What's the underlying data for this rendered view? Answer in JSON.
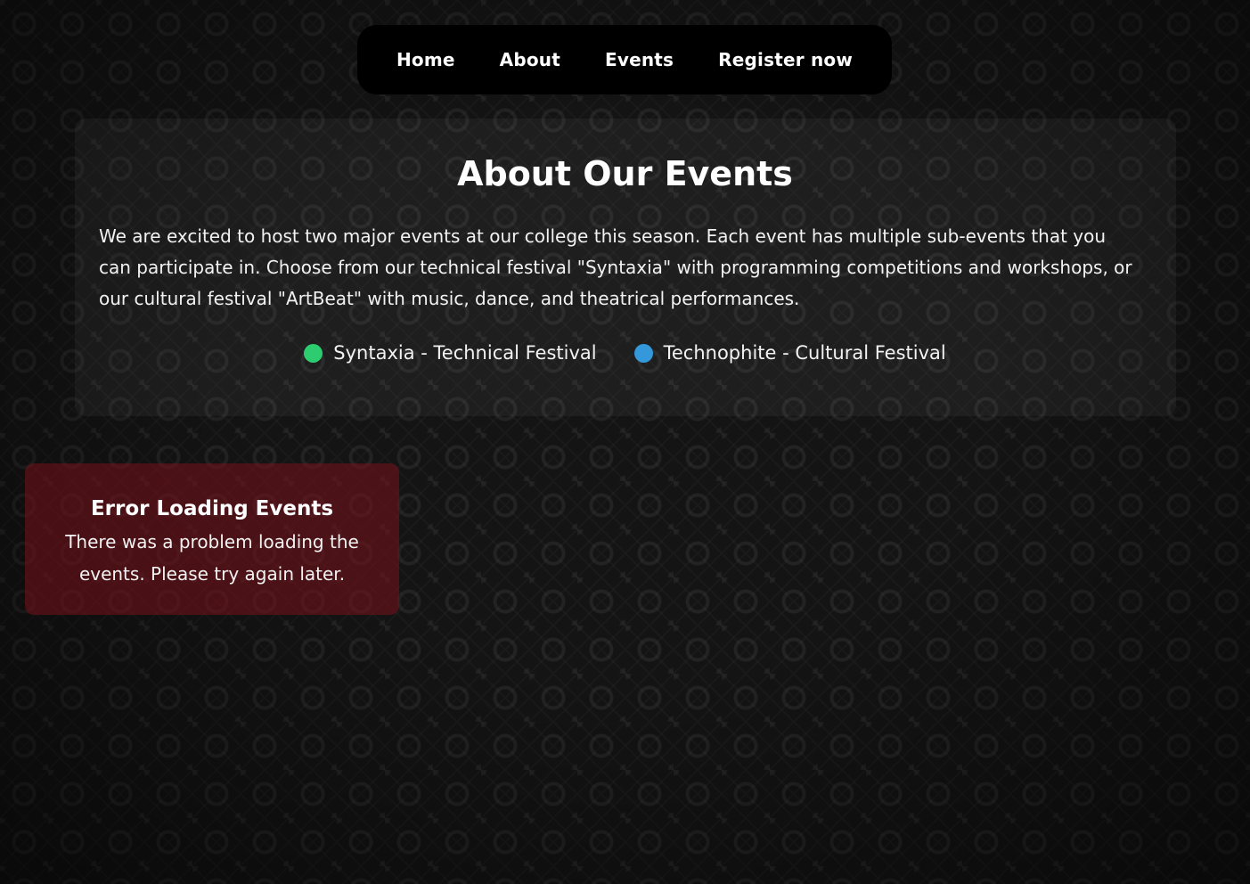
{
  "nav": {
    "items": [
      {
        "label": "Home"
      },
      {
        "label": "About"
      },
      {
        "label": "Events"
      },
      {
        "label": "Register now"
      }
    ]
  },
  "about": {
    "title": "About Our Events",
    "description": "We are excited to host two major events at our college this season. Each event has multiple sub-events that you can participate in. Choose from our technical festival \"Syntaxia\" with programming competitions and workshops, or our cultural festival \"ArtBeat\" with music, dance, and theatrical performances.",
    "legend": [
      {
        "label": "Syntaxia - Technical Festival",
        "color": "#2ecc71"
      },
      {
        "label": "Technophite - Cultural Festival",
        "color": "#3498db"
      }
    ]
  },
  "error": {
    "title": "Error Loading Events",
    "message": "There was a problem loading the events. Please try again later."
  }
}
